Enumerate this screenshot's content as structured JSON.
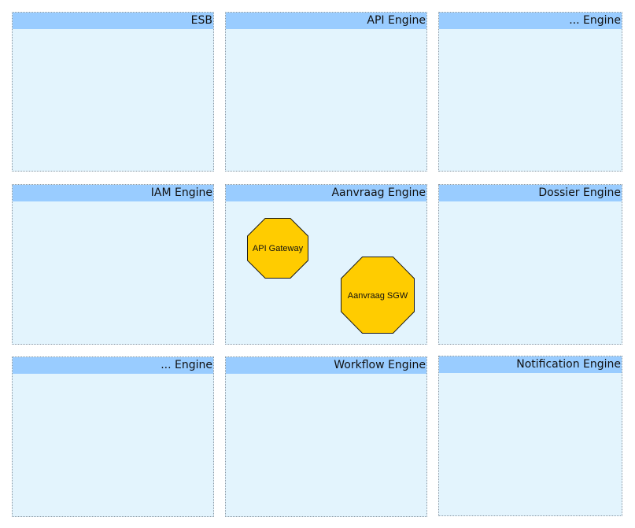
{
  "panels": [
    {
      "title": "ESB"
    },
    {
      "title": "API Engine"
    },
    {
      "title": "... Engine"
    },
    {
      "title": "IAM Engine"
    },
    {
      "title": "Aanvraag Engine"
    },
    {
      "title": "Dossier Engine"
    },
    {
      "title": "... Engine"
    },
    {
      "title": "Workflow Engine"
    },
    {
      "title": "Notification Engine"
    }
  ],
  "components": [
    {
      "label": "API Gateway"
    },
    {
      "label": "Aanvraag SGW"
    }
  ],
  "colors": {
    "panel_fill": "#e3f4fd",
    "header_fill": "#99ccff",
    "component_fill": "#ffcc00"
  }
}
